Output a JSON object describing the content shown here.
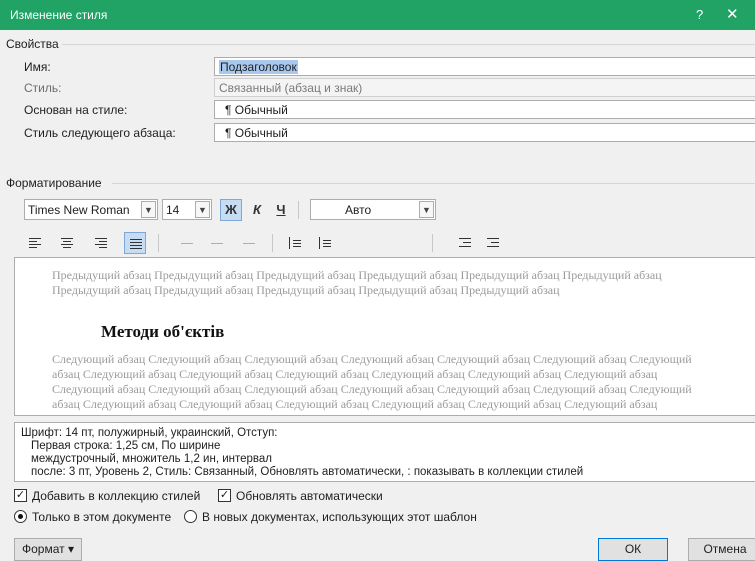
{
  "window": {
    "title": "Изменение стиля",
    "help": "?",
    "close": "✕"
  },
  "properties": {
    "group_label": "Свойства",
    "name_label": "Имя:",
    "name_value": "Подзаголовок",
    "style_type_label": "Стиль:",
    "style_type_value": "Связанный (абзац и знак)",
    "based_on_label": "Основан на стиле:",
    "based_on_value": "¶ Обычный",
    "next_style_label": "Стиль следующего абзаца:",
    "next_style_value": "¶ Обычный"
  },
  "formatting": {
    "group_label": "Форматирование",
    "font": "Times New Roman",
    "size": "14",
    "bold": "Ж",
    "italic": "К",
    "underline": "Ч",
    "color": "Авто"
  },
  "preview": {
    "prev_text": "Предыдущий абзац Предыдущий абзац Предыдущий абзац Предыдущий абзац Предыдущий абзац Предыдущий абзац Предыдущий абзац Предыдущий абзац Предыдущий абзац Предыдущий абзац Предыдущий абзац",
    "sample": "Методи об'єктів",
    "next_text": "Следующий абзац Следующий абзац Следующий абзац Следующий абзац Следующий абзац Следующий абзац Следующий абзац Следующий абзац Следующий абзац Следующий абзац Следующий абзац Следующий абзац Следующий абзац Следующий абзац Следующий абзац Следующий абзац Следующий абзац Следующий абзац Следующий абзац Следующий абзац Следующий абзац Следующий абзац Следующий абзац Следующий абзац Следующий абзац Следующий абзац"
  },
  "description": {
    "line1": "Шрифт: 14 пт, полужирный, украинский, Отступ:",
    "line2": "Первая строка:  1,25 см, По ширине",
    "line3": "междустрочный,  множитель 1,2 ин, интервал",
    "line4": "после: 3 пт, Уровень 2, Стиль: Связанный, Обновлять автоматически, : показывать в коллекции стилей"
  },
  "options": {
    "add_to_gallery": "Добавить в коллекцию стилей",
    "auto_update": "Обновлять автоматически",
    "only_this_doc": "Только в этом документе",
    "new_docs": "В новых документах, использующих этот шаблон"
  },
  "buttons": {
    "format": "Формат ▾",
    "ok": "ОК",
    "cancel": "Отмена"
  }
}
